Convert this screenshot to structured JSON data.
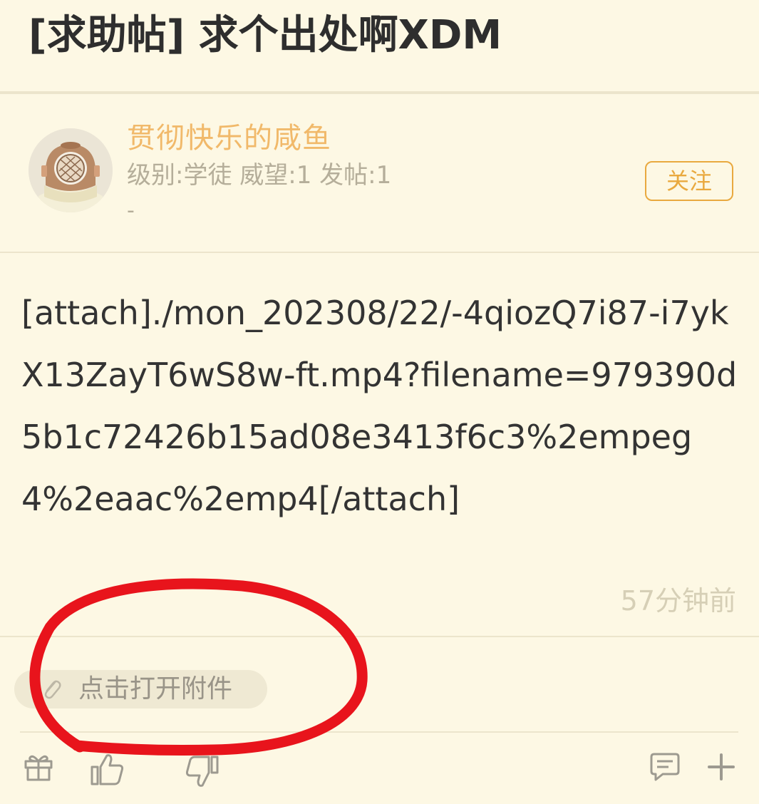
{
  "post": {
    "title": "[求助帖] 求个出处啊XDM",
    "content": "[attach]./mon_202308/22/-4qiozQ7i87-i7ykX13ZayT6wS8w-ft.mp4?filename=979390d5b1c72426b15ad08e3413f6c3%2empeg4%2eaac%2emp4[/attach]",
    "time": "57分钟前"
  },
  "author": {
    "name": "贯彻快乐的咸鱼",
    "meta": "级别:学徒 威望:1 发帖:1",
    "meta_extra": "-",
    "follow_label": "关注",
    "avatar_icon": "diving-helmet-avatar"
  },
  "attachment": {
    "label": "点击打开附件",
    "icon": "paperclip-icon"
  },
  "actions": {
    "icons": [
      "gift-icon",
      "thumbs-up-icon",
      "thumbs-down-icon",
      "comment-icon",
      "plus-icon"
    ]
  },
  "colors": {
    "background": "#FDF8E4",
    "username": "#F1B96A",
    "accent": "#E9A93F",
    "annotation": "#E8141C"
  }
}
